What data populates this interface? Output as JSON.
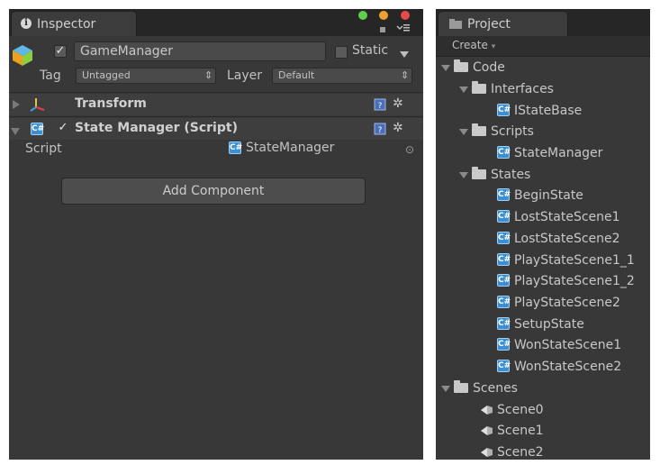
{
  "inspector": {
    "tab_label": "Inspector",
    "object_name": "GameManager",
    "static_label": "Static",
    "tag_label": "Tag",
    "tag_value": "Untagged",
    "layer_label": "Layer",
    "layer_value": "Default",
    "components": [
      {
        "name": "Transform"
      },
      {
        "name": "State Manager (Script)",
        "enabled": true
      }
    ],
    "script_label": "Script",
    "script_value": "StateManager",
    "add_component_label": "Add Component"
  },
  "project": {
    "tab_label": "Project",
    "create_label": "Create",
    "tree": {
      "code": "Code",
      "interfaces": "Interfaces",
      "istatebase": "IStateBase",
      "scripts": "Scripts",
      "statemanager": "StateManager",
      "states": "States",
      "state_files": [
        "BeginState",
        "LostStateScene1",
        "LostStateScene2",
        "PlayStateScene1_1",
        "PlayStateScene1_2",
        "PlayStateScene2",
        "SetupState",
        "WonStateScene1",
        "WonStateScene2"
      ],
      "scenes": "Scenes",
      "scene_files": [
        "Scene0",
        "Scene1",
        "Scene2"
      ]
    }
  },
  "colors": {
    "panel_bg": "#383838",
    "tab_bar": "#262626",
    "script_icon": "#3d8fd1"
  }
}
